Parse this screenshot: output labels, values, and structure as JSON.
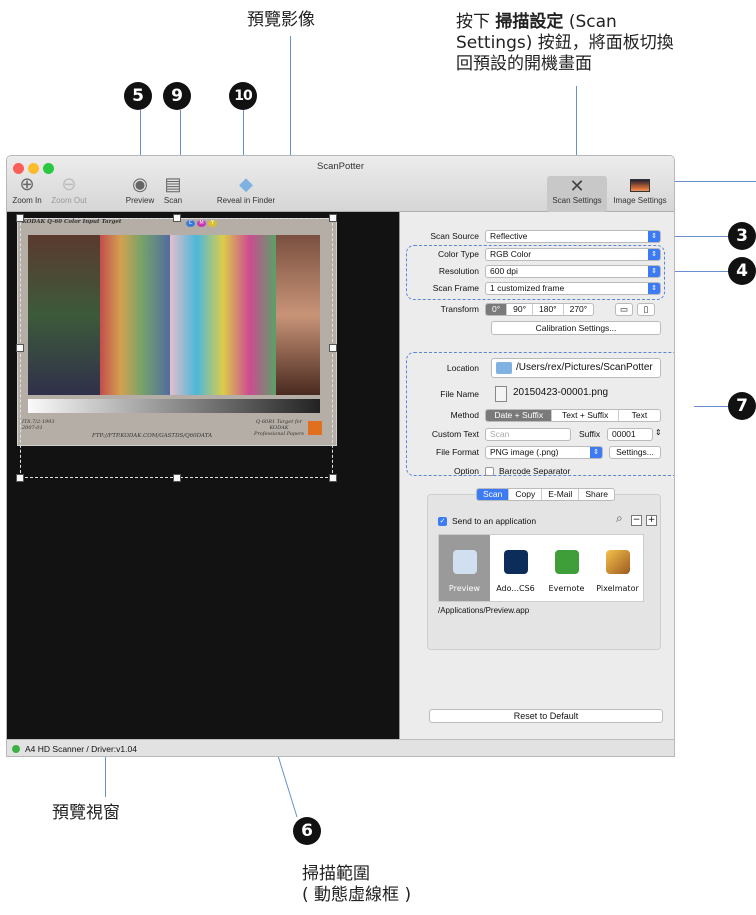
{
  "callouts": {
    "preview_image": "預覽影像",
    "scan_settings_line1": "按下",
    "scan_settings_bold": "掃描設定",
    "scan_settings_line1b": "(Scan",
    "scan_settings_line2": "Settings) 按鈕，將面板切換",
    "scan_settings_line3": "回預設的開機畫面",
    "preview_window": "預覽視窗",
    "scan_area_line1": "掃描範圍",
    "scan_area_line2": "( 動態虛線框 )"
  },
  "badges": {
    "b5": "5",
    "b9": "9",
    "b10": "10",
    "b3": "3",
    "b4": "4",
    "b7": "7",
    "b6": "6"
  },
  "window": {
    "title": "ScanPotter",
    "toolbar": {
      "zoom_in": "Zoom In",
      "zoom_out": "Zoom Out",
      "preview": "Preview",
      "scan": "Scan",
      "reveal": "Reveal in Finder",
      "scan_settings": "Scan Settings",
      "image_settings": "Image Settings"
    },
    "target_header": "KODAK Q-60 Color Input Target",
    "target_footer_left": "IT8.7/2-1993\n2007:01",
    "target_footer_mid": "FTP://FTP.KODAK.COM/GASTDS/Q60DATA",
    "target_footer_right": "Q-60R1 Target for\nKODAK\nProfessional Papers",
    "target_cmy": [
      "C",
      "M",
      "Y"
    ]
  },
  "panel": {
    "scan_source_label": "Scan Source",
    "scan_source_value": "Reflective",
    "color_type_label": "Color Type",
    "color_type_value": "RGB Color",
    "resolution_label": "Resolution",
    "resolution_value": "600 dpi",
    "scan_frame_label": "Scan Frame",
    "scan_frame_value": "1 customized frame",
    "transform_label": "Transform",
    "transform_options": [
      "0°",
      "90°",
      "180°",
      "270°"
    ],
    "calibration": "Calibration Settings...",
    "location_label": "Location",
    "location_value": "/Users/rex/Pictures/ScanPotter",
    "file_name_label": "File Name",
    "file_name_value": "20150423-00001.png",
    "method_label": "Method",
    "method_options": [
      "Date + Suffix",
      "Text + Suffix",
      "Text"
    ],
    "custom_text_label": "Custom Text",
    "custom_text_placeholder": "Scan",
    "suffix_label": "Suffix",
    "suffix_value": "00001",
    "file_format_label": "File Format",
    "file_format_value": "PNG image (.png)",
    "settings_btn": "Settings...",
    "option_label": "Option",
    "barcode": "Barcode Separator",
    "tabs": [
      "Scan",
      "Copy",
      "E-Mail",
      "Share"
    ],
    "send_to_app": "Send to an application",
    "apps": [
      "Preview",
      "Ado...CS6",
      "Evernote",
      "Pixelmator"
    ],
    "app_path": "/Applications/Preview.app",
    "reset": "Reset to Default"
  },
  "status": "A4 HD Scanner / Driver:v1.04",
  "colors": {
    "accent": "#3d7bf5",
    "callout_line": "#6a8fd0",
    "status_dot": "#3cb043"
  }
}
